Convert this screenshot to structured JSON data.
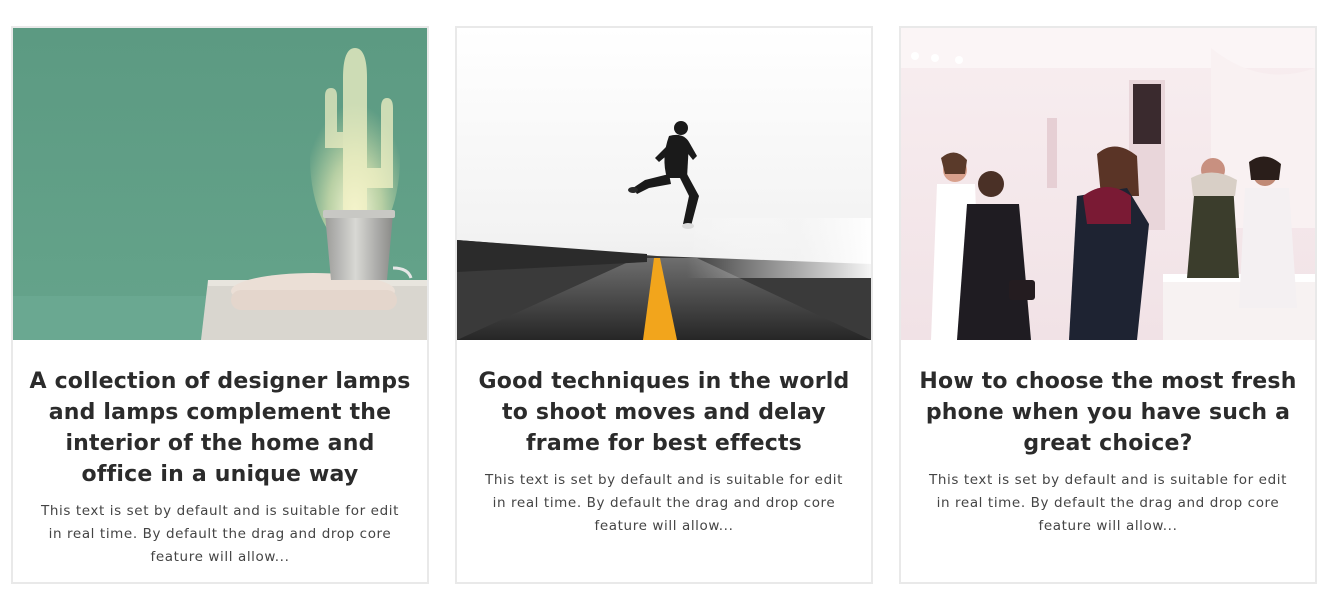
{
  "cards": [
    {
      "image_alt": "cactus-lamp-photo",
      "title": "A collection of designer lamps and lamps complement the interior of the home and office in a unique way",
      "text": "This text is set by default and is suitable for edit in real time. By default the drag and drop core feature will allow..."
    },
    {
      "image_alt": "jumping-man-road-photo",
      "title": "Good techniques in the world to shoot moves and delay frame for best effects",
      "text": "This text is set by default and is suitable for edit in real time. By default the drag and drop core feature will allow..."
    },
    {
      "image_alt": "beauty-store-shoppers-photo",
      "title": "How to choose the most fresh phone when you have such a great choice?",
      "text": "This text is set by default and is suitable for edit in real time. By default the drag and drop core feature will allow..."
    }
  ],
  "colors": {
    "title": "#2b2b2b",
    "text": "#444444",
    "card_border": "#e9e9e9",
    "lamp_wall": "#5e9c84"
  }
}
